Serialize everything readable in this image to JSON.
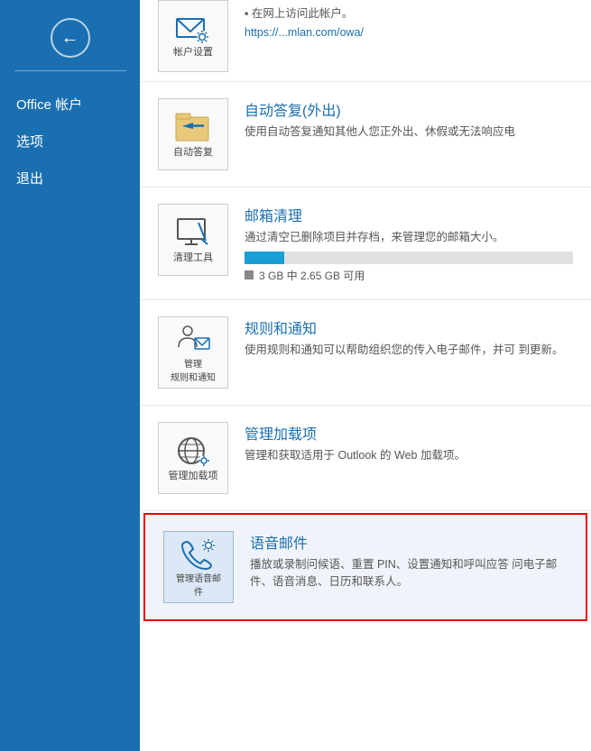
{
  "sidebar": {
    "back_label": "←",
    "items": [
      {
        "id": "office-account",
        "label": "Office 帐户"
      },
      {
        "id": "options",
        "label": "选项"
      },
      {
        "id": "signout",
        "label": "退出"
      }
    ]
  },
  "main": {
    "top_partial": {
      "icon_label": "帐户设置",
      "desc_line1": "在网上访问此帐户。",
      "desc_line2": "https://...mlan.com/owa/"
    },
    "items": [
      {
        "id": "auto-reply",
        "icon_label": "自动答复",
        "title": "自动答复(外出)",
        "desc": "使用自动答复通知其他人您正外出、休假或无法响应电"
      },
      {
        "id": "mailbox-cleanup",
        "icon_label": "清理工具",
        "title": "邮箱清理",
        "desc": "通过清空已删除项目并存档，来管理您的邮箱大小。",
        "has_progress": true,
        "progress_label": "3 GB 中 2.65 GB 可用",
        "progress_pct": 12
      },
      {
        "id": "rules-notifications",
        "icon_label": "管理\n规则和通知",
        "title": "规则和通知",
        "desc": "使用规则和通知可以帮助组织您的传入电子邮件，并可\n到更新。"
      },
      {
        "id": "manage-addins",
        "icon_label": "管理加载项",
        "title": "管理加载项",
        "desc": "管理和获取适用于 Outlook 的 Web 加载项。"
      },
      {
        "id": "voicemail",
        "icon_label": "管理语音邮\n件",
        "title": "语音邮件",
        "desc": "播放或录制问候语、重置 PIN、设置通知和呼叫应答\n问电子邮件、语音消息、日历和联系人。",
        "highlighted": true
      }
    ]
  }
}
